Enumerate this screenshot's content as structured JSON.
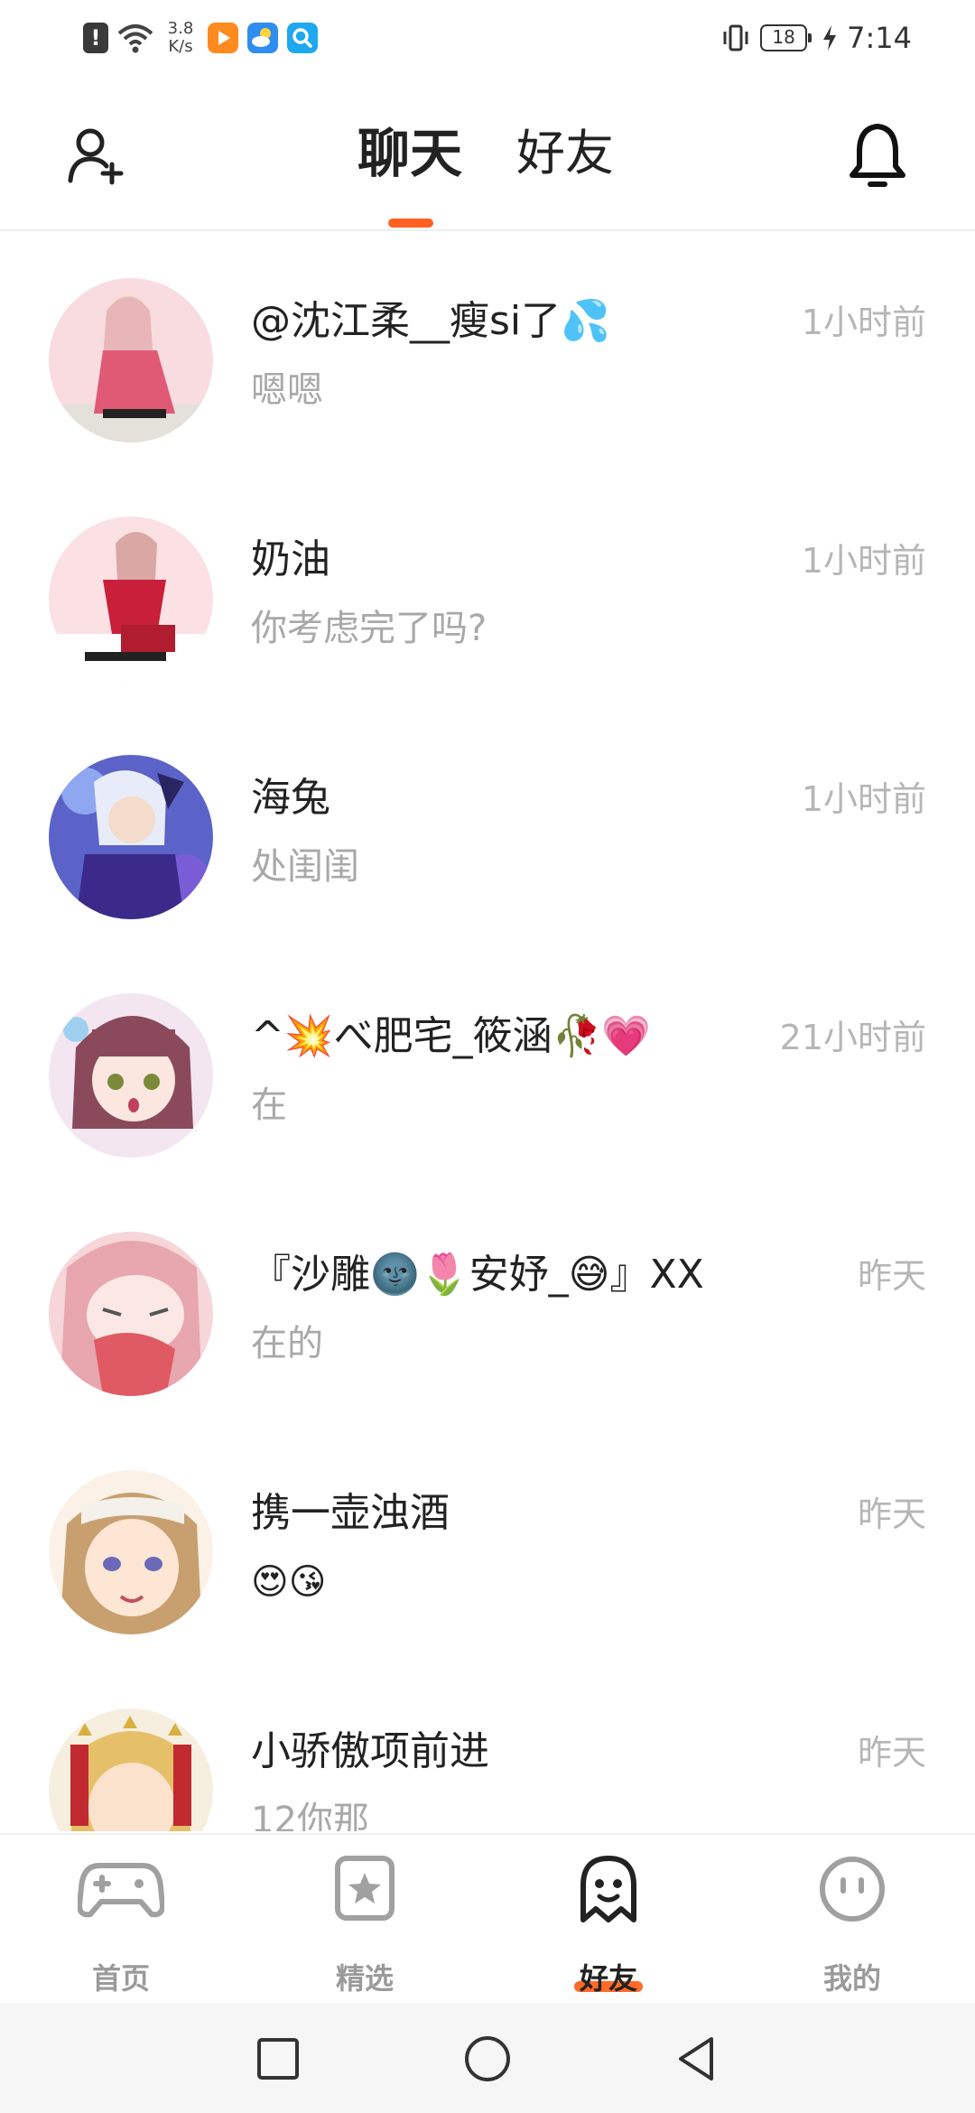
{
  "status_bar": {
    "warn_glyph": "!",
    "net_speed_value": "3.8",
    "net_speed_unit": "K/s",
    "battery_level": "18",
    "time": "7:14",
    "icons": [
      "alert-icon",
      "wifi-icon",
      "video-app-icon",
      "weather-app-icon",
      "search-app-icon",
      "vibrate-icon",
      "battery-icon",
      "charging-icon"
    ]
  },
  "header": {
    "tabs": [
      {
        "label": "聊天",
        "active": true
      },
      {
        "label": "好友",
        "active": false
      }
    ],
    "accent": "#ff6020",
    "left_icon": "add-friend-icon",
    "right_icon": "bell-icon"
  },
  "chats": [
    {
      "name": "@沈江柔__瘦si了💦",
      "preview": "嗯嗯",
      "time": "1小时前"
    },
    {
      "name": "奶油",
      "preview": "你考虑完了吗?",
      "time": "1小时前"
    },
    {
      "name": "海兔",
      "preview": "处闺闺",
      "time": "1小时前"
    },
    {
      "name": "^💥べ肥宅_筱涵🥀💗",
      "preview": "在",
      "time": "21小时前"
    },
    {
      "name": "『沙雕🌚🌷安妤_😅』XX",
      "preview": "在的",
      "time": "昨天"
    },
    {
      "name": "携一壶浊酒",
      "preview": "😍😘",
      "time": "昨天"
    },
    {
      "name": "小骄傲项前进",
      "preview": "12你那",
      "time": "昨天"
    }
  ],
  "bottom_nav": [
    {
      "label": "首页",
      "icon": "gamepad-icon",
      "active": false
    },
    {
      "label": "精选",
      "icon": "star-icon",
      "active": false
    },
    {
      "label": "好友",
      "icon": "ghost-icon",
      "active": true
    },
    {
      "label": "我的",
      "icon": "smiley-icon",
      "active": false
    }
  ],
  "system_nav": [
    "recent-apps-icon",
    "home-icon",
    "back-icon"
  ]
}
